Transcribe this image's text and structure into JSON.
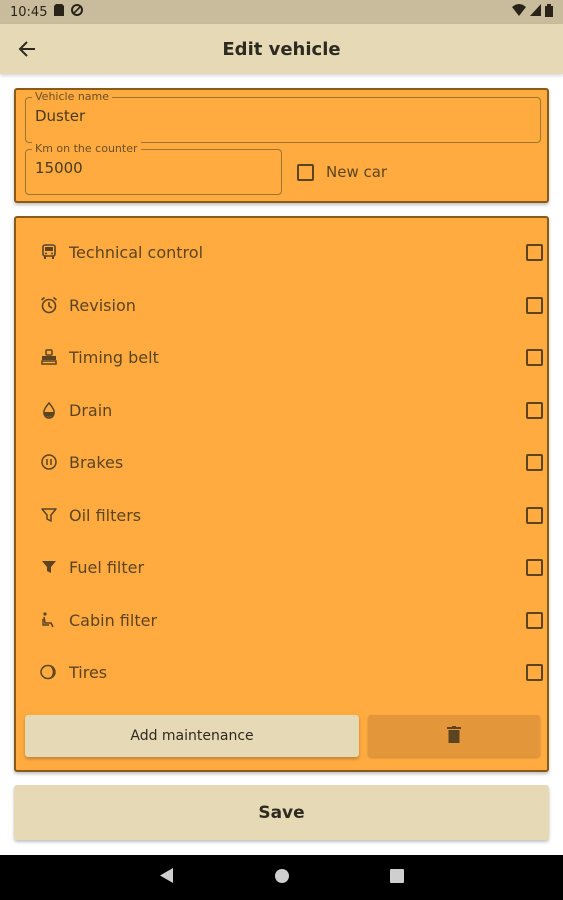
{
  "status_bar": {
    "time": "10:45",
    "icons": [
      "sd-card-icon",
      "sync-icon",
      "wifi-icon",
      "signal-icon",
      "battery-icon"
    ]
  },
  "app_bar": {
    "title": "Edit vehicle",
    "back_icon": "arrow-back-icon"
  },
  "vehicle": {
    "name_label": "Vehicle name",
    "name_value": "Duster",
    "km_label": "Km on the counter",
    "km_value": "15000",
    "new_car_label": "New car",
    "new_car_checked": false
  },
  "maintenance": {
    "items": [
      {
        "label": "Technical control",
        "icon": "car-inspection-icon",
        "checked": false
      },
      {
        "label": "Revision",
        "icon": "alarm-clock-icon",
        "checked": false
      },
      {
        "label": "Timing belt",
        "icon": "engine-icon",
        "checked": false
      },
      {
        "label": "Drain",
        "icon": "oil-drop-icon",
        "checked": false
      },
      {
        "label": "Brakes",
        "icon": "brake-disc-icon",
        "checked": false
      },
      {
        "label": "Oil filters",
        "icon": "filter-outline-icon",
        "checked": false
      },
      {
        "label": "Fuel filter",
        "icon": "filter-icon",
        "checked": false
      },
      {
        "label": "Cabin filter",
        "icon": "car-seat-icon",
        "checked": false
      },
      {
        "label": "Tires",
        "icon": "tire-icon",
        "checked": false
      }
    ],
    "add_button_label": "Add maintenance",
    "delete_icon": "trash-icon"
  },
  "save_button_label": "Save",
  "nav_bar": {
    "icons": [
      "back-triangle-icon",
      "home-circle-icon",
      "recents-square-icon"
    ]
  },
  "colors": {
    "card": "#ffab40",
    "card_border": "#8a5a1a",
    "appbar": "#e5d9b6",
    "button": "#e5d9b6",
    "delete_button": "#e3973a",
    "text": "#5c4423"
  }
}
